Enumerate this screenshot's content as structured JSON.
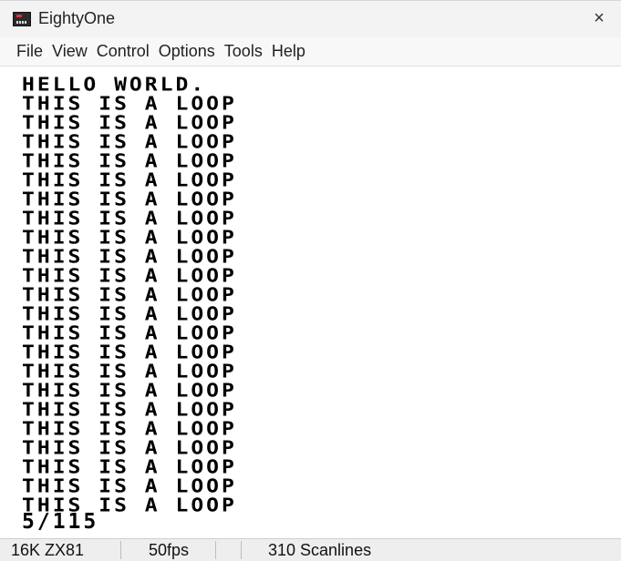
{
  "window": {
    "title": "EightyOne",
    "close_glyph": "×"
  },
  "menu": [
    "File",
    "View",
    "Control",
    "Options",
    "Tools",
    "Help"
  ],
  "screen": {
    "header_line": "HELLO WORLD.",
    "loop_lines": [
      "THIS IS A LOOP",
      "THIS IS A LOOP",
      "THIS IS A LOOP",
      "THIS IS A LOOP",
      "THIS IS A LOOP",
      "THIS IS A LOOP",
      "THIS IS A LOOP",
      "THIS IS A LOOP",
      "THIS IS A LOOP",
      "THIS IS A LOOP",
      "THIS IS A LOOP",
      "THIS IS A LOOP",
      "THIS IS A LOOP",
      "THIS IS A LOOP",
      "THIS IS A LOOP",
      "THIS IS A LOOP",
      "THIS IS A LOOP",
      "THIS IS A LOOP",
      "THIS IS A LOOP",
      "THIS IS A LOOP",
      "THIS IS A LOOP",
      "THIS IS A LOOP"
    ],
    "report_code": "5/115"
  },
  "status": {
    "machine": "16K ZX81",
    "fps": "50fps",
    "scanlines": "310 Scanlines"
  }
}
